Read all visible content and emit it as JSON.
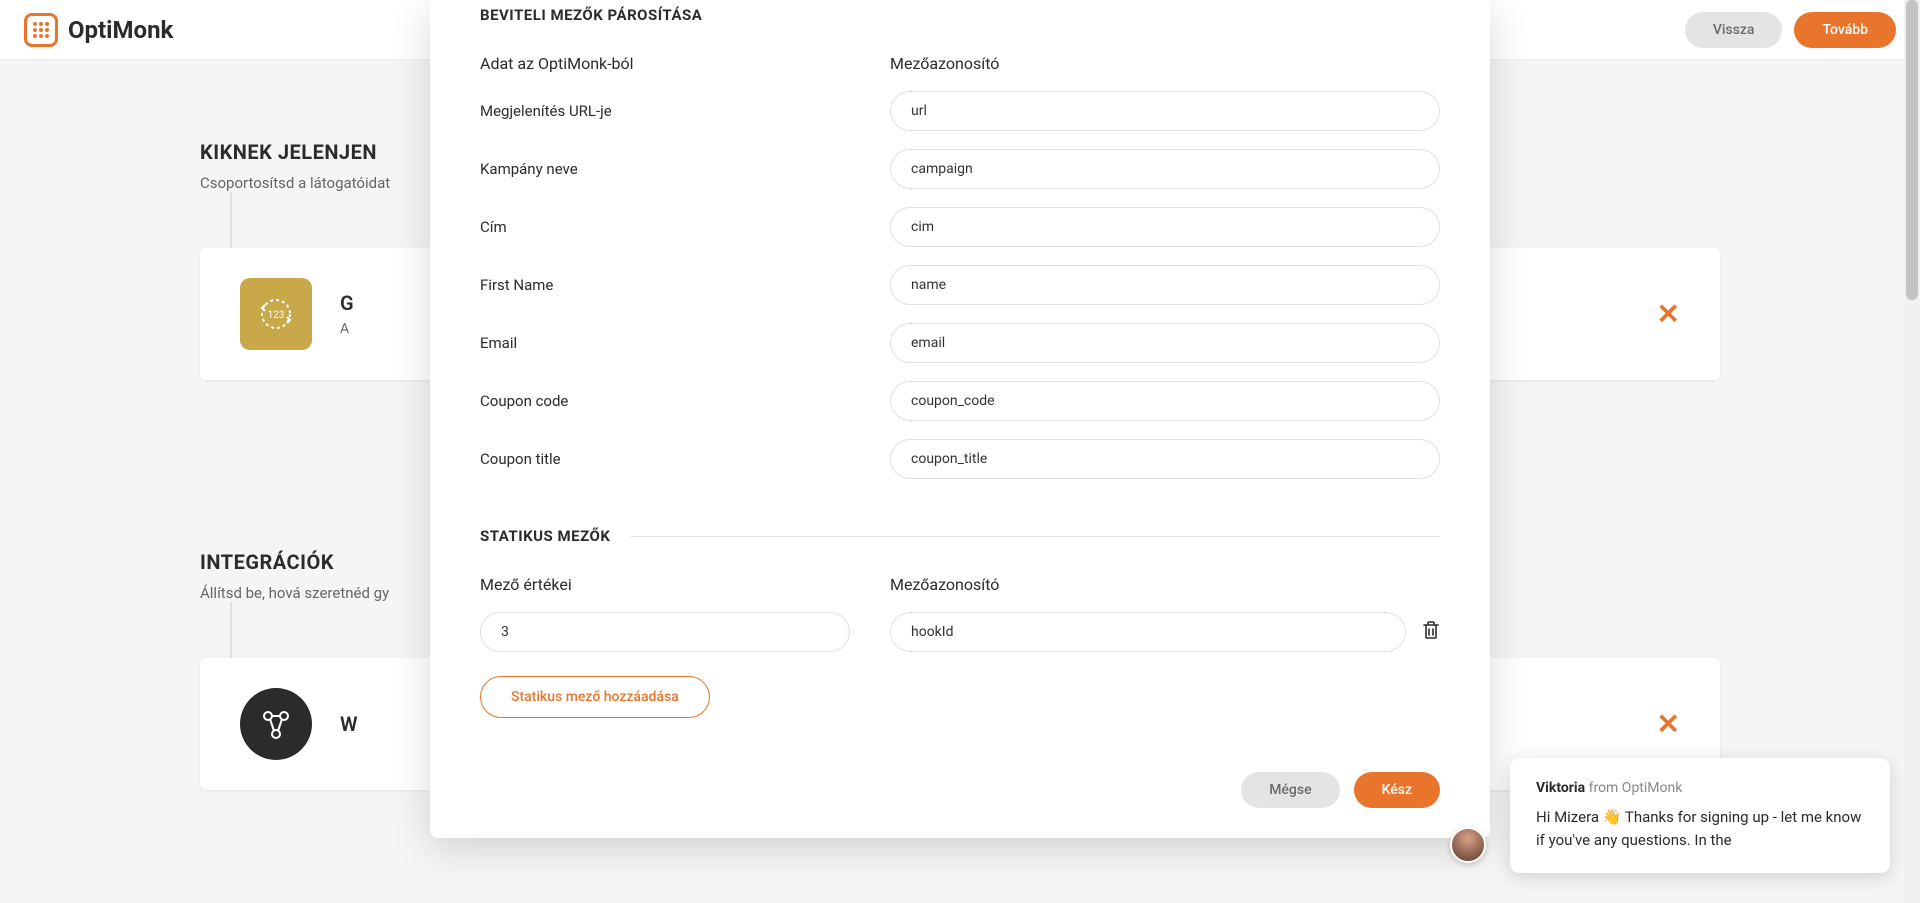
{
  "header": {
    "brand": "OptiMonk",
    "back_label": "Vissza",
    "next_label": "Tovább"
  },
  "page": {
    "audience_title": "KIKNEK JELENJEN",
    "audience_sub": "Csoportosítsd a látogatóidat",
    "card1_title": "G",
    "card1_sub": "A",
    "integrations_title": "INTEGRÁCIÓK",
    "integrations_sub": "Állítsd be, hová szeretnéd gy",
    "card2_title": "W"
  },
  "modal": {
    "section1_title": "BEVITELI MEZŐK PÁROSÍTÁSA",
    "col_left_header": "Adat az OptiMonk-ból",
    "col_right_header": "Mezőazonosító",
    "fields": [
      {
        "label": "Megjelenítés URL-je",
        "value": "url"
      },
      {
        "label": "Kampány neve",
        "value": "campaign"
      },
      {
        "label": "Cím",
        "value": "cim"
      },
      {
        "label": "First Name",
        "value": "name"
      },
      {
        "label": "Email",
        "value": "email"
      },
      {
        "label": "Coupon code",
        "value": "coupon_code"
      },
      {
        "label": "Coupon title",
        "value": "coupon_title"
      }
    ],
    "section2_title": "STATIKUS MEZŐK",
    "static_left_header": "Mező értékei",
    "static_right_header": "Mezőazonosító",
    "static_row": {
      "value": "3",
      "id": "hookId"
    },
    "add_static_label": "Statikus mező hozzáadása",
    "cancel_label": "Mégse",
    "done_label": "Kész"
  },
  "chat": {
    "name": "Viktoria",
    "from": " from OptiMonk",
    "message": "Hi Mizera 👋 Thanks for signing up - let me know if you've any questions. In the"
  }
}
